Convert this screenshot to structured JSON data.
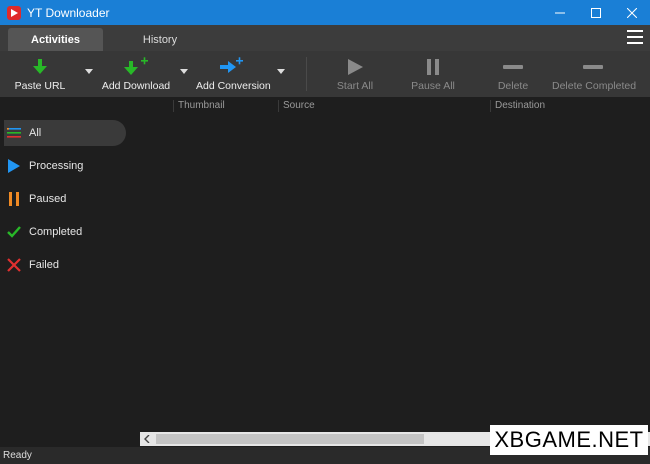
{
  "window": {
    "title": "YT Downloader",
    "accent": "#1a7fd6"
  },
  "tabs": [
    {
      "label": "Activities",
      "active": true
    },
    {
      "label": "History",
      "active": false
    }
  ],
  "toolbar": {
    "paste_url": "Paste URL",
    "add_download": "Add Download",
    "add_conversion": "Add Conversion",
    "start_all": "Start All",
    "pause_all": "Pause All",
    "delete": "Delete",
    "delete_completed": "Delete Completed"
  },
  "sidebar": {
    "items": [
      {
        "label": "All",
        "icon": "list-icon",
        "active": true
      },
      {
        "label": "Processing",
        "icon": "play-icon"
      },
      {
        "label": "Paused",
        "icon": "pause-icon"
      },
      {
        "label": "Completed",
        "icon": "check-icon"
      },
      {
        "label": "Failed",
        "icon": "x-icon"
      }
    ]
  },
  "columns": [
    "Thumbnail",
    "Source",
    "Destination"
  ],
  "status": "Ready",
  "watermark": "XBGAME.NET",
  "colors": {
    "green": "#28b828",
    "blue": "#2196f3",
    "orange": "#f08a24",
    "red": "#e03030"
  }
}
